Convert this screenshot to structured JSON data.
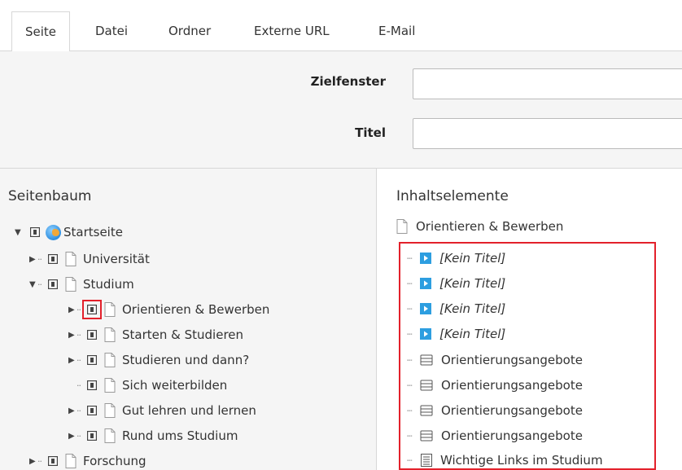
{
  "tabs": [
    {
      "label": "Seite"
    },
    {
      "label": "Datei"
    },
    {
      "label": "Ordner"
    },
    {
      "label": "Externe URL"
    },
    {
      "label": "E-Mail"
    }
  ],
  "form": {
    "target_label": "Zielfenster",
    "title_label": "Titel",
    "target_value": "",
    "title_value": ""
  },
  "page_tree": {
    "heading": "Seitenbaum",
    "items": [
      {
        "label": "Startseite"
      },
      {
        "label": "Universität"
      },
      {
        "label": "Studium"
      },
      {
        "label": "Orientieren & Bewerben"
      },
      {
        "label": "Starten & Studieren"
      },
      {
        "label": "Studieren und dann?"
      },
      {
        "label": "Sich weiterbilden"
      },
      {
        "label": "Gut lehren und lernen"
      },
      {
        "label": "Rund ums Studium"
      },
      {
        "label": "Forschung"
      }
    ]
  },
  "content_elements": {
    "heading": "Inhaltselemente",
    "page": "Orientieren & Bewerben",
    "items": [
      {
        "label": "[Kein Titel]"
      },
      {
        "label": "[Kein Titel]"
      },
      {
        "label": "[Kein Titel]"
      },
      {
        "label": "[Kein Titel]"
      },
      {
        "label": "Orientierungsangebote"
      },
      {
        "label": "Orientierungsangebote"
      },
      {
        "label": "Orientierungsangebote"
      },
      {
        "label": "Orientierungsangebote"
      },
      {
        "label": "Wichtige Links im Studium"
      }
    ]
  },
  "colors": {
    "highlight_red": "#e3212b",
    "media_blue": "#2d9ee0",
    "panel_bg": "#f5f5f5"
  }
}
